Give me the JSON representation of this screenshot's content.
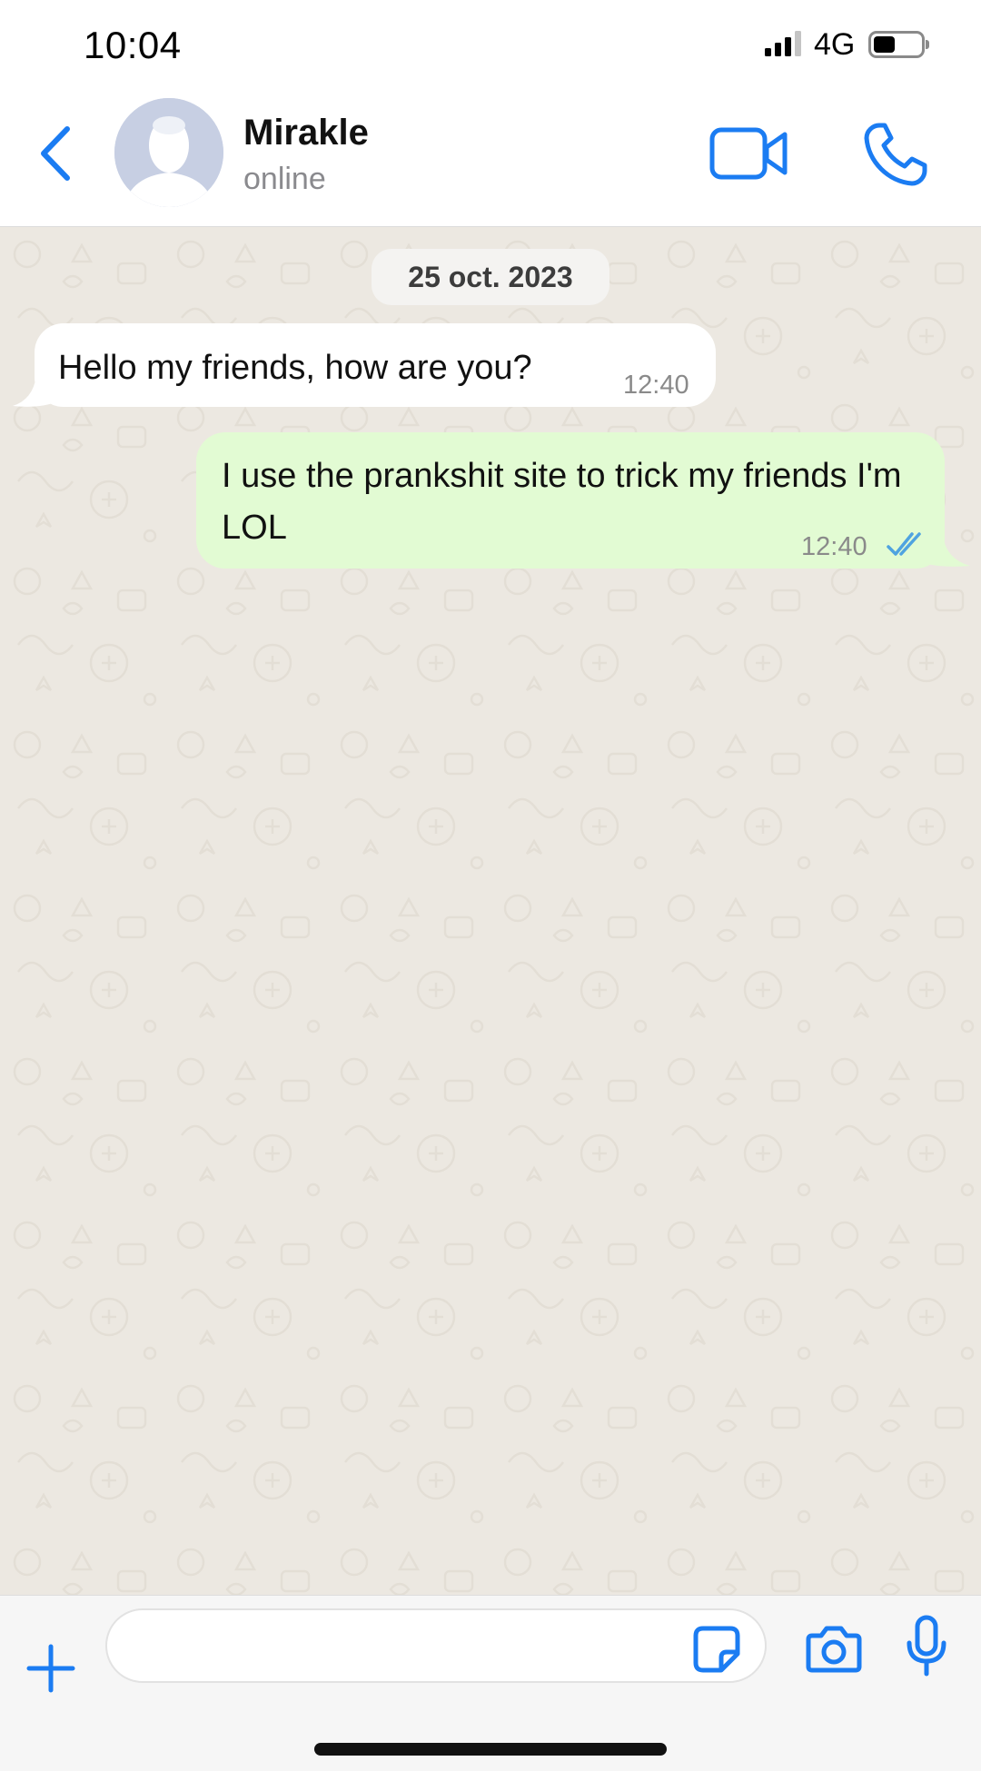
{
  "status_bar": {
    "time": "10:04",
    "network": "4G",
    "signal_bars": 3,
    "signal_bars_total": 4,
    "battery_level": 0.45
  },
  "header": {
    "contact_name": "Mirakle",
    "contact_status": "online",
    "icons": [
      "chevron-left-icon",
      "avatar-placeholder",
      "video-camera-icon",
      "phone-icon"
    ],
    "accent_color": "#1b7cf2"
  },
  "chat": {
    "date_label": "25 oct. 2023",
    "wallpaper_color": "#ece8e1",
    "messages": [
      {
        "direction": "incoming",
        "text": "Hello my friends, how are you?",
        "time": "12:40",
        "bubble_color": "#ffffff"
      },
      {
        "direction": "outgoing",
        "text": "I use the prankshit site to trick my friends I'm LOL",
        "time": "12:40",
        "read_status": "read",
        "read_status_icon": "double-check-icon",
        "bubble_color": "#e2fbd3"
      }
    ]
  },
  "input_bar": {
    "message_value": "",
    "icons": [
      "plus-icon",
      "sticker-icon",
      "camera-icon",
      "microphone-icon"
    ]
  }
}
